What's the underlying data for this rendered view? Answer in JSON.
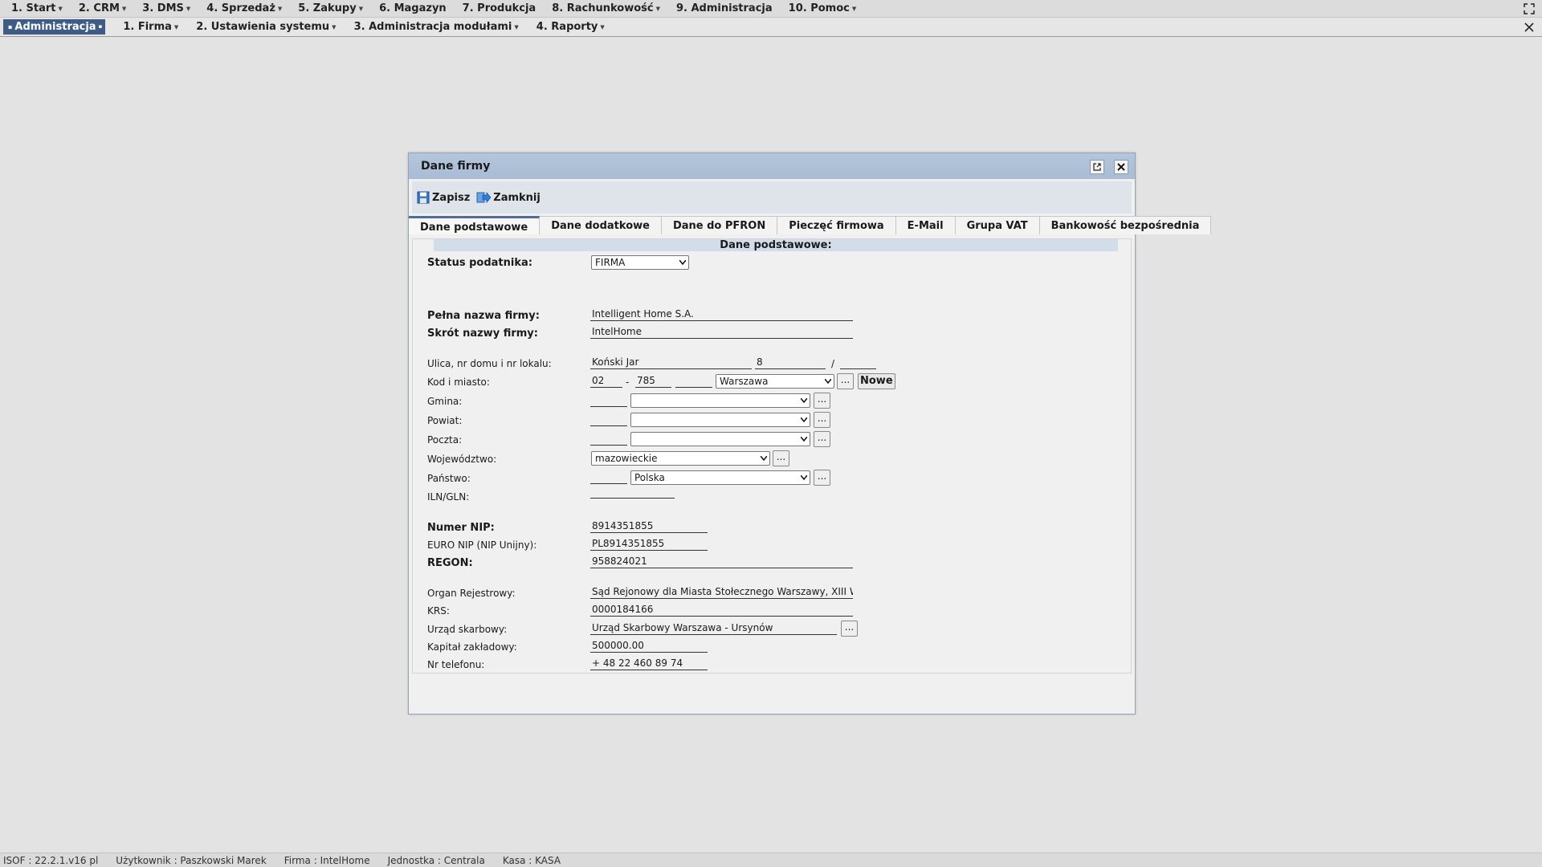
{
  "menubar": {
    "items": [
      {
        "label": "1. Start",
        "caret": true
      },
      {
        "label": "2. CRM",
        "caret": true
      },
      {
        "label": "3. DMS",
        "caret": true
      },
      {
        "label": "4. Sprzedaż",
        "caret": true
      },
      {
        "label": "5. Zakupy",
        "caret": true
      },
      {
        "label": "6. Magazyn",
        "caret": false
      },
      {
        "label": "7. Produkcja",
        "caret": false
      },
      {
        "label": "8. Rachunkowość",
        "caret": true
      },
      {
        "label": "9. Administracja",
        "caret": false
      },
      {
        "label": "10. Pomoc",
        "caret": true
      }
    ],
    "maximize_icon": "fullscreen-icon"
  },
  "submenubar": {
    "active": "Administracja",
    "items": [
      {
        "label": "1. Firma"
      },
      {
        "label": "2. Ustawienia systemu"
      },
      {
        "label": "3. Administracja modułami"
      },
      {
        "label": "4. Raporty"
      }
    ],
    "close_icon": "close-icon"
  },
  "dialog": {
    "title": "Dane firmy",
    "toolbar": {
      "save_label": "Zapisz",
      "close_label": "Zamknij"
    },
    "tabs": [
      "Dane podstawowe",
      "Dane dodatkowe",
      "Dane do PFRON",
      "Pieczęć firmowa",
      "E-Mail",
      "Grupa VAT",
      "Bankowość bezpośrednia"
    ],
    "active_tab": "Dane podstawowe",
    "section_title": "Dane podstawowe:",
    "form": {
      "status_label": "Status podatnika:",
      "status_value": "FIRMA",
      "full_name_label": "Pełna nazwa firmy:",
      "full_name_value": "Intelligent Home S.A.",
      "short_name_label": "Skrót nazwy firmy:",
      "short_name_value": "IntelHome",
      "street_label": "Ulica, nr domu i nr lokalu:",
      "street_value": "Koński Jar",
      "house_value": "8",
      "flat_value": "",
      "postal_label": "Kod i miasto:",
      "postal_1": "02",
      "postal_2": "785",
      "postal_3": "",
      "city_value": "Warszawa",
      "new_button": "Nowe",
      "gmina_label": "Gmina:",
      "powiat_label": "Powiat:",
      "poczta_label": "Poczta:",
      "wojewodztwo_label": "Województwo:",
      "wojewodztwo_value": "mazowieckie",
      "panstwo_label": "Państwo:",
      "panstwo_value": "Polska",
      "iln_label": "ILN/GLN:",
      "nip_label": "Numer NIP:",
      "nip_value": "8914351855",
      "euro_nip_label": "EURO NIP (NIP Unijny):",
      "euro_nip_value": "PL8914351855",
      "regon_label": "REGON:",
      "regon_value": "958824021",
      "organ_label": "Organ Rejestrowy:",
      "organ_value": "Sąd Rejonowy dla Miasta Stołecznego Warszawy, XIII Wydział",
      "krs_label": "KRS:",
      "krs_value": "0000184166",
      "urzad_label": "Urząd skarbowy:",
      "urzad_value": "Urząd Skarbowy Warszawa - Ursynów",
      "kapital_label": "Kapitał zakładowy:",
      "kapital_value": "500000.00",
      "telefon_label": "Nr telefonu:",
      "telefon_value": "+ 48 22 460 89 74",
      "dots_label": "..."
    }
  },
  "statusbar": {
    "version": "ISOF : 22.2.1.v16 pl",
    "user": "Użytkownik : Paszkowski Marek",
    "firm": "Firma : IntelHome",
    "unit": "Jednostka : Centrala",
    "cash": "Kasa : KASA"
  },
  "colors": {
    "active_menu_bg": "#3e5c86",
    "dialog_title_bg": "#b4c6dc",
    "section_header_bg": "#d3dde9"
  }
}
